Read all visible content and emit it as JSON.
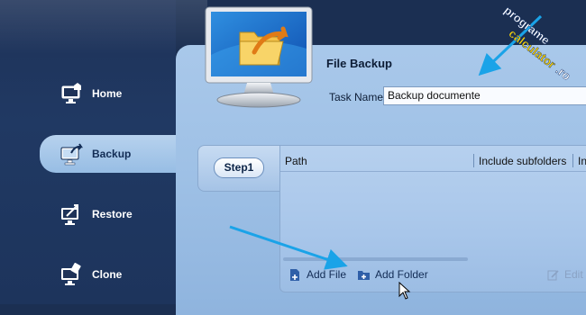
{
  "sidebar": {
    "items": [
      {
        "label": "Home",
        "icon": "home-monitor-icon",
        "active": false
      },
      {
        "label": "Backup",
        "icon": "backup-monitor-icon",
        "active": true
      },
      {
        "label": "Restore",
        "icon": "restore-monitor-icon",
        "active": false
      },
      {
        "label": "Clone",
        "icon": "clone-monitor-icon",
        "active": false
      }
    ]
  },
  "header": {
    "title": "File Backup",
    "task_name_label": "Task Name",
    "task_name_value": "Backup documente"
  },
  "step": {
    "label": "Step1"
  },
  "table": {
    "columns": [
      "Path",
      "Include subfolders",
      "In"
    ]
  },
  "toolbar": {
    "add_file_label": "Add File",
    "add_folder_label": "Add Folder",
    "edit_label": "Edit"
  },
  "watermark": {
    "part1": "programe",
    "part2": "calculator",
    "part3": ".ro"
  },
  "colors": {
    "accent_arrow": "#1aa3e8",
    "sidebar_bg": "#1e3258",
    "active_item": "#a9c9ec",
    "panel_bg": "#a9c8ea"
  }
}
